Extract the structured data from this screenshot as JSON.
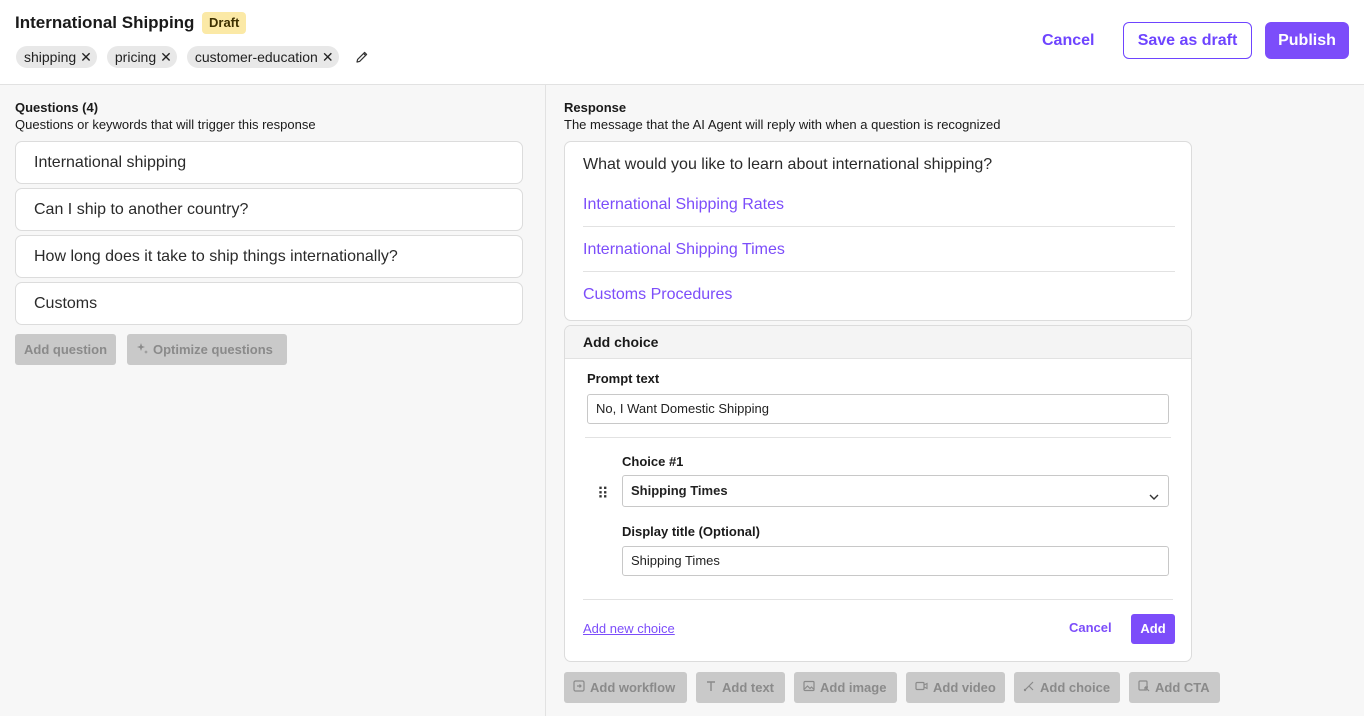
{
  "header": {
    "title": "International Shipping",
    "badge": "Draft",
    "tags": [
      "shipping",
      "pricing",
      "customer-education"
    ],
    "cancel": "Cancel",
    "save_draft": "Save as draft",
    "publish": "Publish"
  },
  "questions": {
    "title": "Questions (4)",
    "subtitle": "Questions or keywords that will trigger this response",
    "items": [
      "International shipping",
      "Can I ship to another country?",
      "How long does it take to ship things internationally?",
      "Customs"
    ],
    "add_question": "Add question",
    "optimize": "Optimize questions"
  },
  "response": {
    "title": "Response",
    "subtitle": "The message that the AI Agent will reply with when a question is recognized",
    "message": "What would you like to learn about international shipping?",
    "links": [
      "International Shipping Rates",
      "International Shipping Times",
      "Customs Procedures"
    ]
  },
  "add_choice": {
    "header": "Add choice",
    "prompt_label": "Prompt text",
    "prompt_value": "No, I Want Domestic Shipping",
    "choice_label": "Choice #1",
    "choice_value": "Shipping Times",
    "display_label": "Display title (Optional)",
    "display_value": "Shipping Times",
    "add_new": "Add new choice",
    "cancel": "Cancel",
    "add": "Add"
  },
  "toolbar": {
    "items": [
      "Add workflow",
      "Add text",
      "Add image",
      "Add video",
      "Add choice",
      "Add CTA"
    ]
  },
  "colors": {
    "accent": "#7c4dfa",
    "badge_bg": "#fbe9a6"
  }
}
